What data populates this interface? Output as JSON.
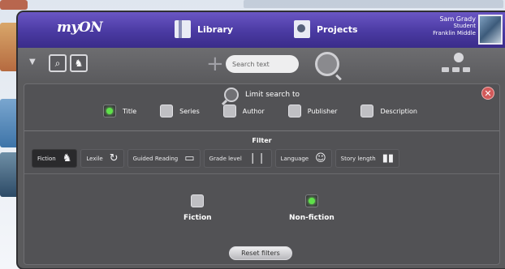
{
  "header": {
    "logo": "myON",
    "nav": [
      {
        "label": "Library",
        "icon": "library-icon"
      },
      {
        "label": "Projects",
        "icon": "projects-icon"
      }
    ],
    "user": {
      "name": "Sam Grady",
      "role": "Student",
      "school": "Franklin Middle"
    }
  },
  "toolbar": {
    "search_placeholder": "Search text"
  },
  "search_panel": {
    "limit_title": "Limit search to",
    "limit_options": [
      {
        "label": "Title",
        "checked": true
      },
      {
        "label": "Series",
        "checked": false
      },
      {
        "label": "Author",
        "checked": false
      },
      {
        "label": "Publisher",
        "checked": false
      },
      {
        "label": "Description",
        "checked": false
      }
    ],
    "filter_title": "Filter",
    "filter_tabs": [
      {
        "label": "Fiction",
        "active": true
      },
      {
        "label": "Lexile",
        "active": false
      },
      {
        "label": "Guided Reading",
        "active": false
      },
      {
        "label": "Grade level",
        "active": false
      },
      {
        "label": "Language",
        "active": false
      },
      {
        "label": "Story length",
        "active": false
      }
    ],
    "type_options": [
      {
        "label": "Fiction",
        "checked": false
      },
      {
        "label": "Non-fiction",
        "checked": true
      }
    ],
    "reset_label": "Reset filters"
  },
  "colors": {
    "topbar": "#4a3aa2",
    "panel": "#525255",
    "check_on": "#5fe04a",
    "close": "#d25a5a"
  }
}
